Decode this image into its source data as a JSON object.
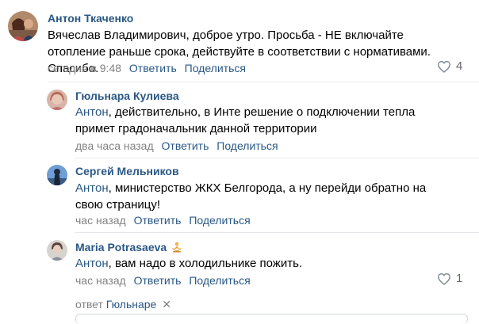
{
  "comments": [
    {
      "author": "Антон Ткаченко",
      "text": "Вячеслав Владимирович, доброе утро. Просьба - НЕ включайте отопление раньше срока, действуйте в соответствии с нормативами. Спасибо.",
      "time": "сегодня в 9:48",
      "reply_label": "Ответить",
      "share_label": "Поделиться",
      "likes": "4"
    },
    {
      "author": "Гюльнара Кулиева",
      "mention": "Антон",
      "text": ", действительно, в Инте решение о подключении тепла примет градоначальник данной территории",
      "time": "два часа назад",
      "reply_label": "Ответить",
      "share_label": "Поделиться"
    },
    {
      "author": "Сергей Мельников",
      "mention": "Антон",
      "text": ", министерство ЖКХ Белгорода, а ну перейди обратно на свою страницу!",
      "time": "час назад",
      "reply_label": "Ответить",
      "share_label": "Поделиться"
    },
    {
      "author": "Maria Potrasaeva",
      "mention": "Антон",
      "text": ", вам надо в холодильнике пожить.",
      "time": "час назад",
      "reply_label": "Ответить",
      "share_label": "Поделиться",
      "likes": "1"
    }
  ],
  "reply_to": {
    "prefix": "ответ",
    "name": "Гюльнаре",
    "clear": "✕"
  },
  "icons": {
    "heart": "heart-icon",
    "emoji": "meditation-emoji-icon"
  },
  "colors": {
    "link": "#2a5885",
    "meta": "#828282",
    "separator": "#e7e8ec"
  }
}
